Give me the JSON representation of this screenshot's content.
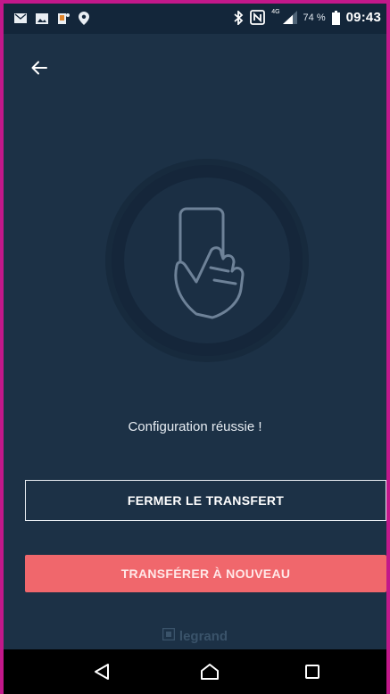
{
  "status_bar": {
    "time": "09:43",
    "battery_percent": "74 %",
    "network_label": "4G",
    "icons_left": [
      "mail-icon",
      "image-icon",
      "app-notification-icon",
      "location-icon"
    ],
    "icons_right": [
      "bluetooth-icon",
      "nfc-icon",
      "signal-icon",
      "battery-icon"
    ]
  },
  "header": {
    "back_icon": "arrow-left-icon"
  },
  "illustration": {
    "icon": "phone-in-hand-icon"
  },
  "message": "Configuration réussie !",
  "buttons": {
    "close_transfer": "FERMER LE TRANSFERT",
    "transfer_again": "TRANSFÉRER À NOUVEAU"
  },
  "brand": {
    "name": "legrand"
  },
  "nav_bar": {
    "icons": [
      "back-triangle-icon",
      "home-icon",
      "recents-icon"
    ]
  },
  "colors": {
    "background": "#1c3146",
    "accent": "#f0676c",
    "border_highlight": "#c2188a"
  }
}
